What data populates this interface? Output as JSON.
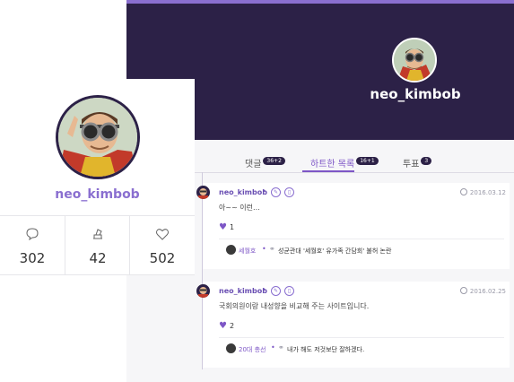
{
  "banner": {
    "username": "neo_kimbob"
  },
  "tabs": [
    {
      "label": "댓글",
      "count": "36+2",
      "active": false
    },
    {
      "label": "하트한 목록",
      "count": "16+1",
      "active": true
    },
    {
      "label": "투표",
      "count": "3",
      "active": false
    }
  ],
  "feed": [
    {
      "username": "neo_kimbob",
      "date": "2016.03.12",
      "text": "아~~ 이런...",
      "likes": "1",
      "ref_user": "세월호",
      "ref_title": "성균관대 '세월호' 유가족 간담회' 불허 논란"
    },
    {
      "username": "neo_kimbob",
      "date": "2016.02.25",
      "text": "국회의원이랑 내성향을 비교해 주는 사이트입니다.",
      "likes": "2",
      "ref_user": "20대 총선",
      "ref_title": "내가 해도 저것보단 잘하겠다."
    }
  ],
  "profile": {
    "username": "neo_kimbob",
    "stats": [
      {
        "icon": "comment-icon",
        "value": "302"
      },
      {
        "icon": "vote-icon",
        "value": "42"
      },
      {
        "icon": "heart-icon",
        "value": "502"
      }
    ]
  },
  "colors": {
    "banner": "#2c2147",
    "accent": "#7d56c6"
  }
}
